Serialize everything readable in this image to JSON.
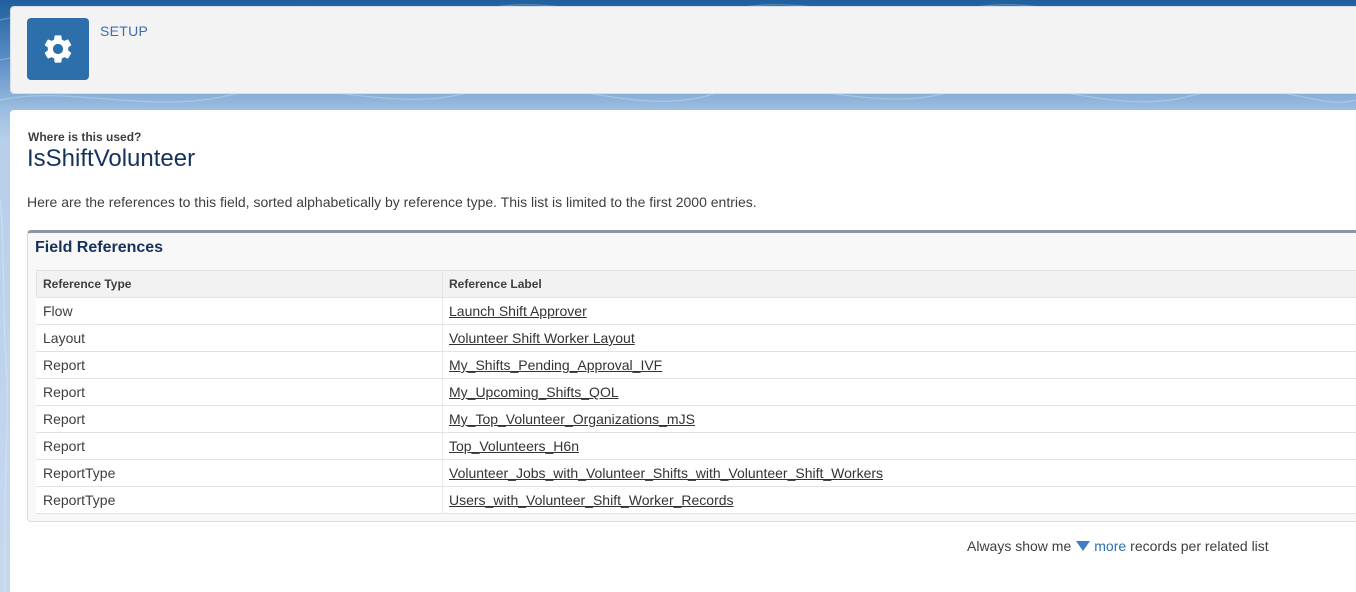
{
  "header": {
    "icon": "gear-icon",
    "title": "SETUP"
  },
  "main": {
    "subtitle": "Where is this used?",
    "title": "IsShiftVolunteer",
    "description": "Here are the references to this field, sorted alphabetically by reference type. This list is limited to the first 2000 entries."
  },
  "field_references": {
    "title": "Field References",
    "columns": [
      "Reference Type",
      "Reference Label"
    ],
    "rows": [
      {
        "type": "Flow",
        "label": "Launch Shift Approver"
      },
      {
        "type": "Layout",
        "label": "Volunteer Shift Worker Layout"
      },
      {
        "type": "Report",
        "label": "My_Shifts_Pending_Approval_IVF"
      },
      {
        "type": "Report",
        "label": "My_Upcoming_Shifts_QOL"
      },
      {
        "type": "Report",
        "label": "My_Top_Volunteer_Organizations_mJS"
      },
      {
        "type": "Report",
        "label": "Top_Volunteers_H6n"
      },
      {
        "type": "ReportType",
        "label": "Volunteer_Jobs_with_Volunteer_Shifts_with_Volunteer_Shift_Workers"
      },
      {
        "type": "ReportType",
        "label": "Users_with_Volunteer_Shift_Worker_Records"
      }
    ]
  },
  "footer": {
    "prefix": "Always show me",
    "icon": "triangle-down-icon",
    "more_label": "more",
    "suffix": "records per related list"
  },
  "colors": {
    "brand": "#2c6fab",
    "title": "#16325c",
    "link_more": "#2c6fab"
  }
}
